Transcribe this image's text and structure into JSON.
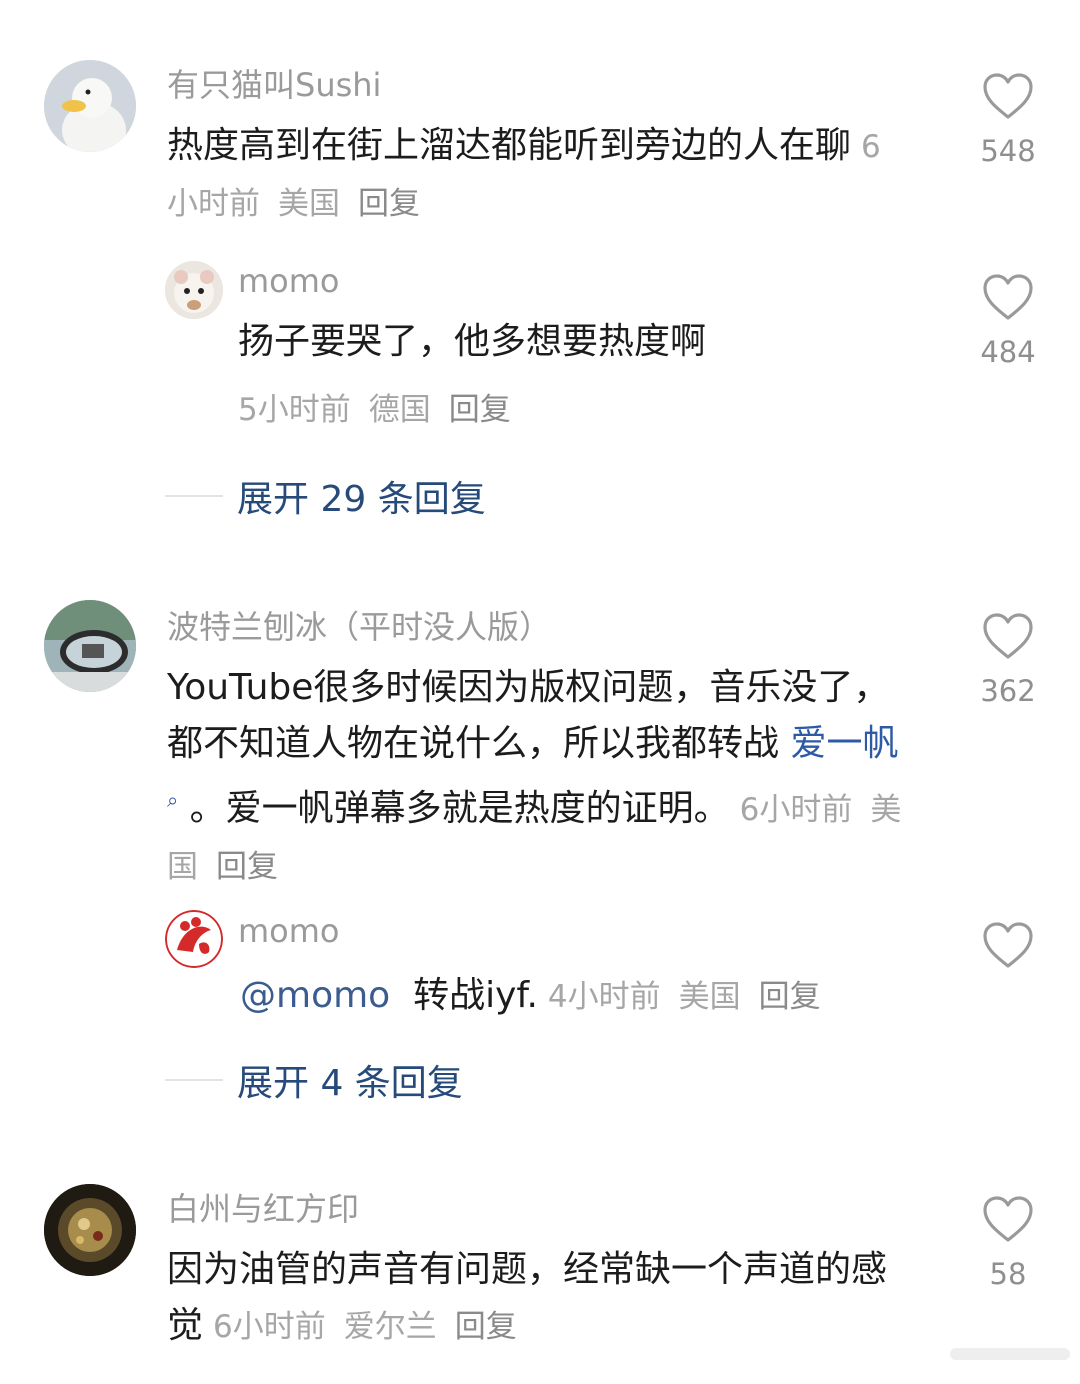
{
  "comments": [
    {
      "username": "有只猫叫Sushi",
      "avatar": "duck-avatar",
      "text": "热度高到在街上溜达都能听到旁边的人在聊",
      "time": "6小时前",
      "location": "美国",
      "reply_label": "回复",
      "likes": "548",
      "replies": [
        {
          "username": "momo",
          "avatar": "hamster-avatar",
          "text": "扬子要哭了，他多想要热度啊",
          "time": "5小时前",
          "location": "德国",
          "reply_label": "回复",
          "likes": "484"
        }
      ],
      "expand_label": "展开 29 条回复"
    },
    {
      "username": "波特兰刨冰（平时没人版）",
      "avatar": "car-mirror-avatar",
      "text_before_link": "YouTube很多时候因为版权问题，音乐没了，都不知道人物在说什么，所以我都转战 ",
      "link_text": "爱一帆",
      "text_after_link": " 。爱一帆弹幕多就是热度的证明。",
      "time": "6小时前",
      "location": "美国",
      "reply_label": "回复",
      "likes": "362",
      "replies": [
        {
          "username": "momo",
          "avatar": "red-logo-avatar",
          "mention": "@momo",
          "text": "转战iyf.",
          "time": "4小时前",
          "location": "美国",
          "reply_label": "回复",
          "likes": ""
        }
      ],
      "expand_label": "展开 4 条回复"
    },
    {
      "username": "白州与红方印",
      "avatar": "dark-photo-avatar",
      "text": "因为油管的声音有问题，经常缺一个声道的感觉",
      "time": "6小时前",
      "location": "爱尔兰",
      "reply_label": "回复",
      "likes": "58"
    }
  ],
  "colors": {
    "username": "#9a9a9a",
    "body_text": "#1c1c1c",
    "meta": "#a6a6a6",
    "expand": "#264a7a",
    "link": "#2d5aa5"
  }
}
